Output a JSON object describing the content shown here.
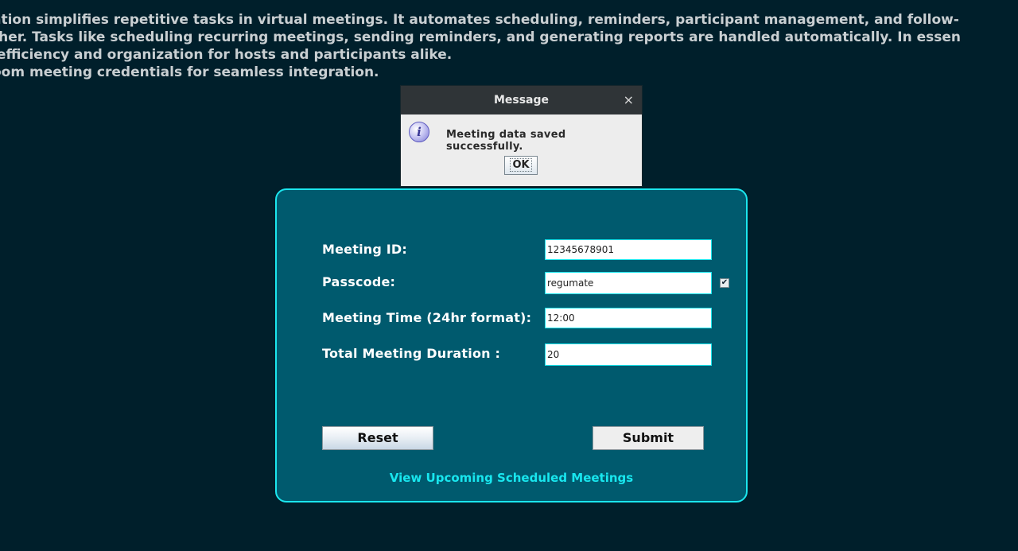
{
  "intro": {
    "line1": "ation simplifies repetitive tasks in virtual meetings. It automates scheduling, reminders, participant management, and follow-",
    "line2": "ther. Tasks like scheduling recurring meetings, sending reminders, and generating reports are handled automatically. In essen",
    "line3": " efficiency and organization for hosts and participants alike.",
    "line4": "oom meeting credentials for seamless integration."
  },
  "form": {
    "meeting_id_label": "Meeting ID:",
    "meeting_id_value": "12345678901",
    "passcode_label": "Passcode:",
    "passcode_value": "regumate",
    "passcode_show_checked": true,
    "time_label": "Meeting Time (24hr format):",
    "time_value": "12:00",
    "duration_label": "Total Meeting Duration :",
    "duration_value": "20",
    "reset_label": "Reset",
    "submit_label": "Submit",
    "view_link": "View Upcoming Scheduled Meetings"
  },
  "dialog": {
    "title": "Message",
    "close_glyph": "×",
    "message": "Meeting data saved successfully.",
    "ok_label": "OK",
    "icon_glyph": "i"
  },
  "colors": {
    "background": "#001f2b",
    "panel": "#005a6e",
    "accent": "#1be6ee"
  }
}
